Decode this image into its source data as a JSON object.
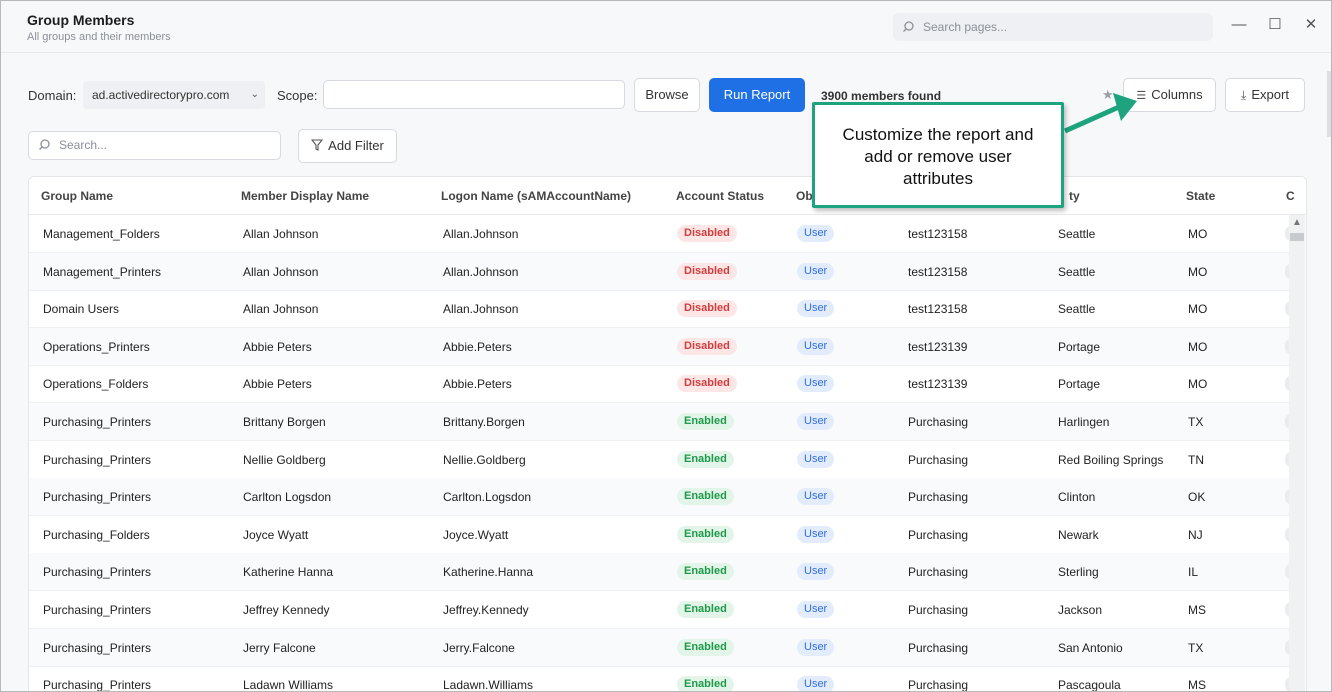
{
  "header": {
    "title": "Group Members",
    "subtitle": "All groups and their members",
    "search_placeholder": "Search pages...",
    "minimize": "—",
    "maximize": "☐",
    "close": "✕"
  },
  "toolbar": {
    "domain_label": "Domain:",
    "domain_value": "ad.activedirectorypro.com",
    "scope_label": "Scope:",
    "scope_value": "",
    "browse_label": "Browse",
    "run_label": "Run Report",
    "found_text": "3900 members found",
    "columns_label": "Columns",
    "export_label": "Export",
    "search_placeholder": "Search...",
    "add_filter_label": "Add Filter"
  },
  "callout": {
    "text_line1": "Customize the report and",
    "text_line2": "add or remove user",
    "text_line3": "attributes"
  },
  "table": {
    "headers": [
      "Group Name",
      "Member Display Name",
      "Logon Name (sAMAccountName)",
      "Account Status",
      "Ob",
      "ty",
      "State",
      "C"
    ],
    "rows": [
      {
        "group": "Management_Folders",
        "display": "Allan Johnson",
        "logon": "Allan.Johnson",
        "status": "Disabled",
        "type": "User",
        "dept": "test123158",
        "city": "Seattle",
        "state": "MO"
      },
      {
        "group": "Management_Printers",
        "display": "Allan Johnson",
        "logon": "Allan.Johnson",
        "status": "Disabled",
        "type": "User",
        "dept": "test123158",
        "city": "Seattle",
        "state": "MO"
      },
      {
        "group": "Domain Users",
        "display": "Allan Johnson",
        "logon": "Allan.Johnson",
        "status": "Disabled",
        "type": "User",
        "dept": "test123158",
        "city": "Seattle",
        "state": "MO"
      },
      {
        "group": "Operations_Printers",
        "display": "Abbie Peters",
        "logon": "Abbie.Peters",
        "status": "Disabled",
        "type": "User",
        "dept": "test123139",
        "city": "Portage",
        "state": "MO"
      },
      {
        "group": "Operations_Folders",
        "display": "Abbie Peters",
        "logon": "Abbie.Peters",
        "status": "Disabled",
        "type": "User",
        "dept": "test123139",
        "city": "Portage",
        "state": "MO"
      },
      {
        "group": "Purchasing_Printers",
        "display": "Brittany Borgen",
        "logon": "Brittany.Borgen",
        "status": "Enabled",
        "type": "User",
        "dept": "Purchasing",
        "city": "Harlingen",
        "state": "TX"
      },
      {
        "group": "Purchasing_Printers",
        "display": "Nellie Goldberg",
        "logon": "Nellie.Goldberg",
        "status": "Enabled",
        "type": "User",
        "dept": "Purchasing",
        "city": "Red Boiling Springs",
        "state": "TN"
      },
      {
        "group": "Purchasing_Printers",
        "display": "Carlton Logsdon",
        "logon": "Carlton.Logsdon",
        "status": "Enabled",
        "type": "User",
        "dept": "Purchasing",
        "city": "Clinton",
        "state": "OK"
      },
      {
        "group": "Purchasing_Folders",
        "display": "Joyce Wyatt",
        "logon": "Joyce.Wyatt",
        "status": "Enabled",
        "type": "User",
        "dept": "Purchasing",
        "city": "Newark",
        "state": "NJ"
      },
      {
        "group": "Purchasing_Printers",
        "display": "Katherine Hanna",
        "logon": "Katherine.Hanna",
        "status": "Enabled",
        "type": "User",
        "dept": "Purchasing",
        "city": "Sterling",
        "state": "IL"
      },
      {
        "group": "Purchasing_Printers",
        "display": "Jeffrey Kennedy",
        "logon": "Jeffrey.Kennedy",
        "status": "Enabled",
        "type": "User",
        "dept": "Purchasing",
        "city": "Jackson",
        "state": "MS"
      },
      {
        "group": "Purchasing_Printers",
        "display": "Jerry Falcone",
        "logon": "Jerry.Falcone",
        "status": "Enabled",
        "type": "User",
        "dept": "Purchasing",
        "city": "San Antonio",
        "state": "TX"
      },
      {
        "group": "Purchasing_Printers",
        "display": "Ladawn Williams",
        "logon": "Ladawn.Williams",
        "status": "Enabled",
        "type": "User",
        "dept": "Purchasing",
        "city": "Pascagoula",
        "state": "MS"
      }
    ]
  },
  "icons": {
    "search": "search-icon",
    "columns": "list-icon",
    "export": "download-icon",
    "filter": "filter-icon",
    "star": "star-icon",
    "chevron": "chevron-down-icon"
  },
  "colors": {
    "primary": "#1f6fe5",
    "callout_border": "#1da47e",
    "disabled": "#d13d3d",
    "enabled": "#1e9a4a"
  }
}
